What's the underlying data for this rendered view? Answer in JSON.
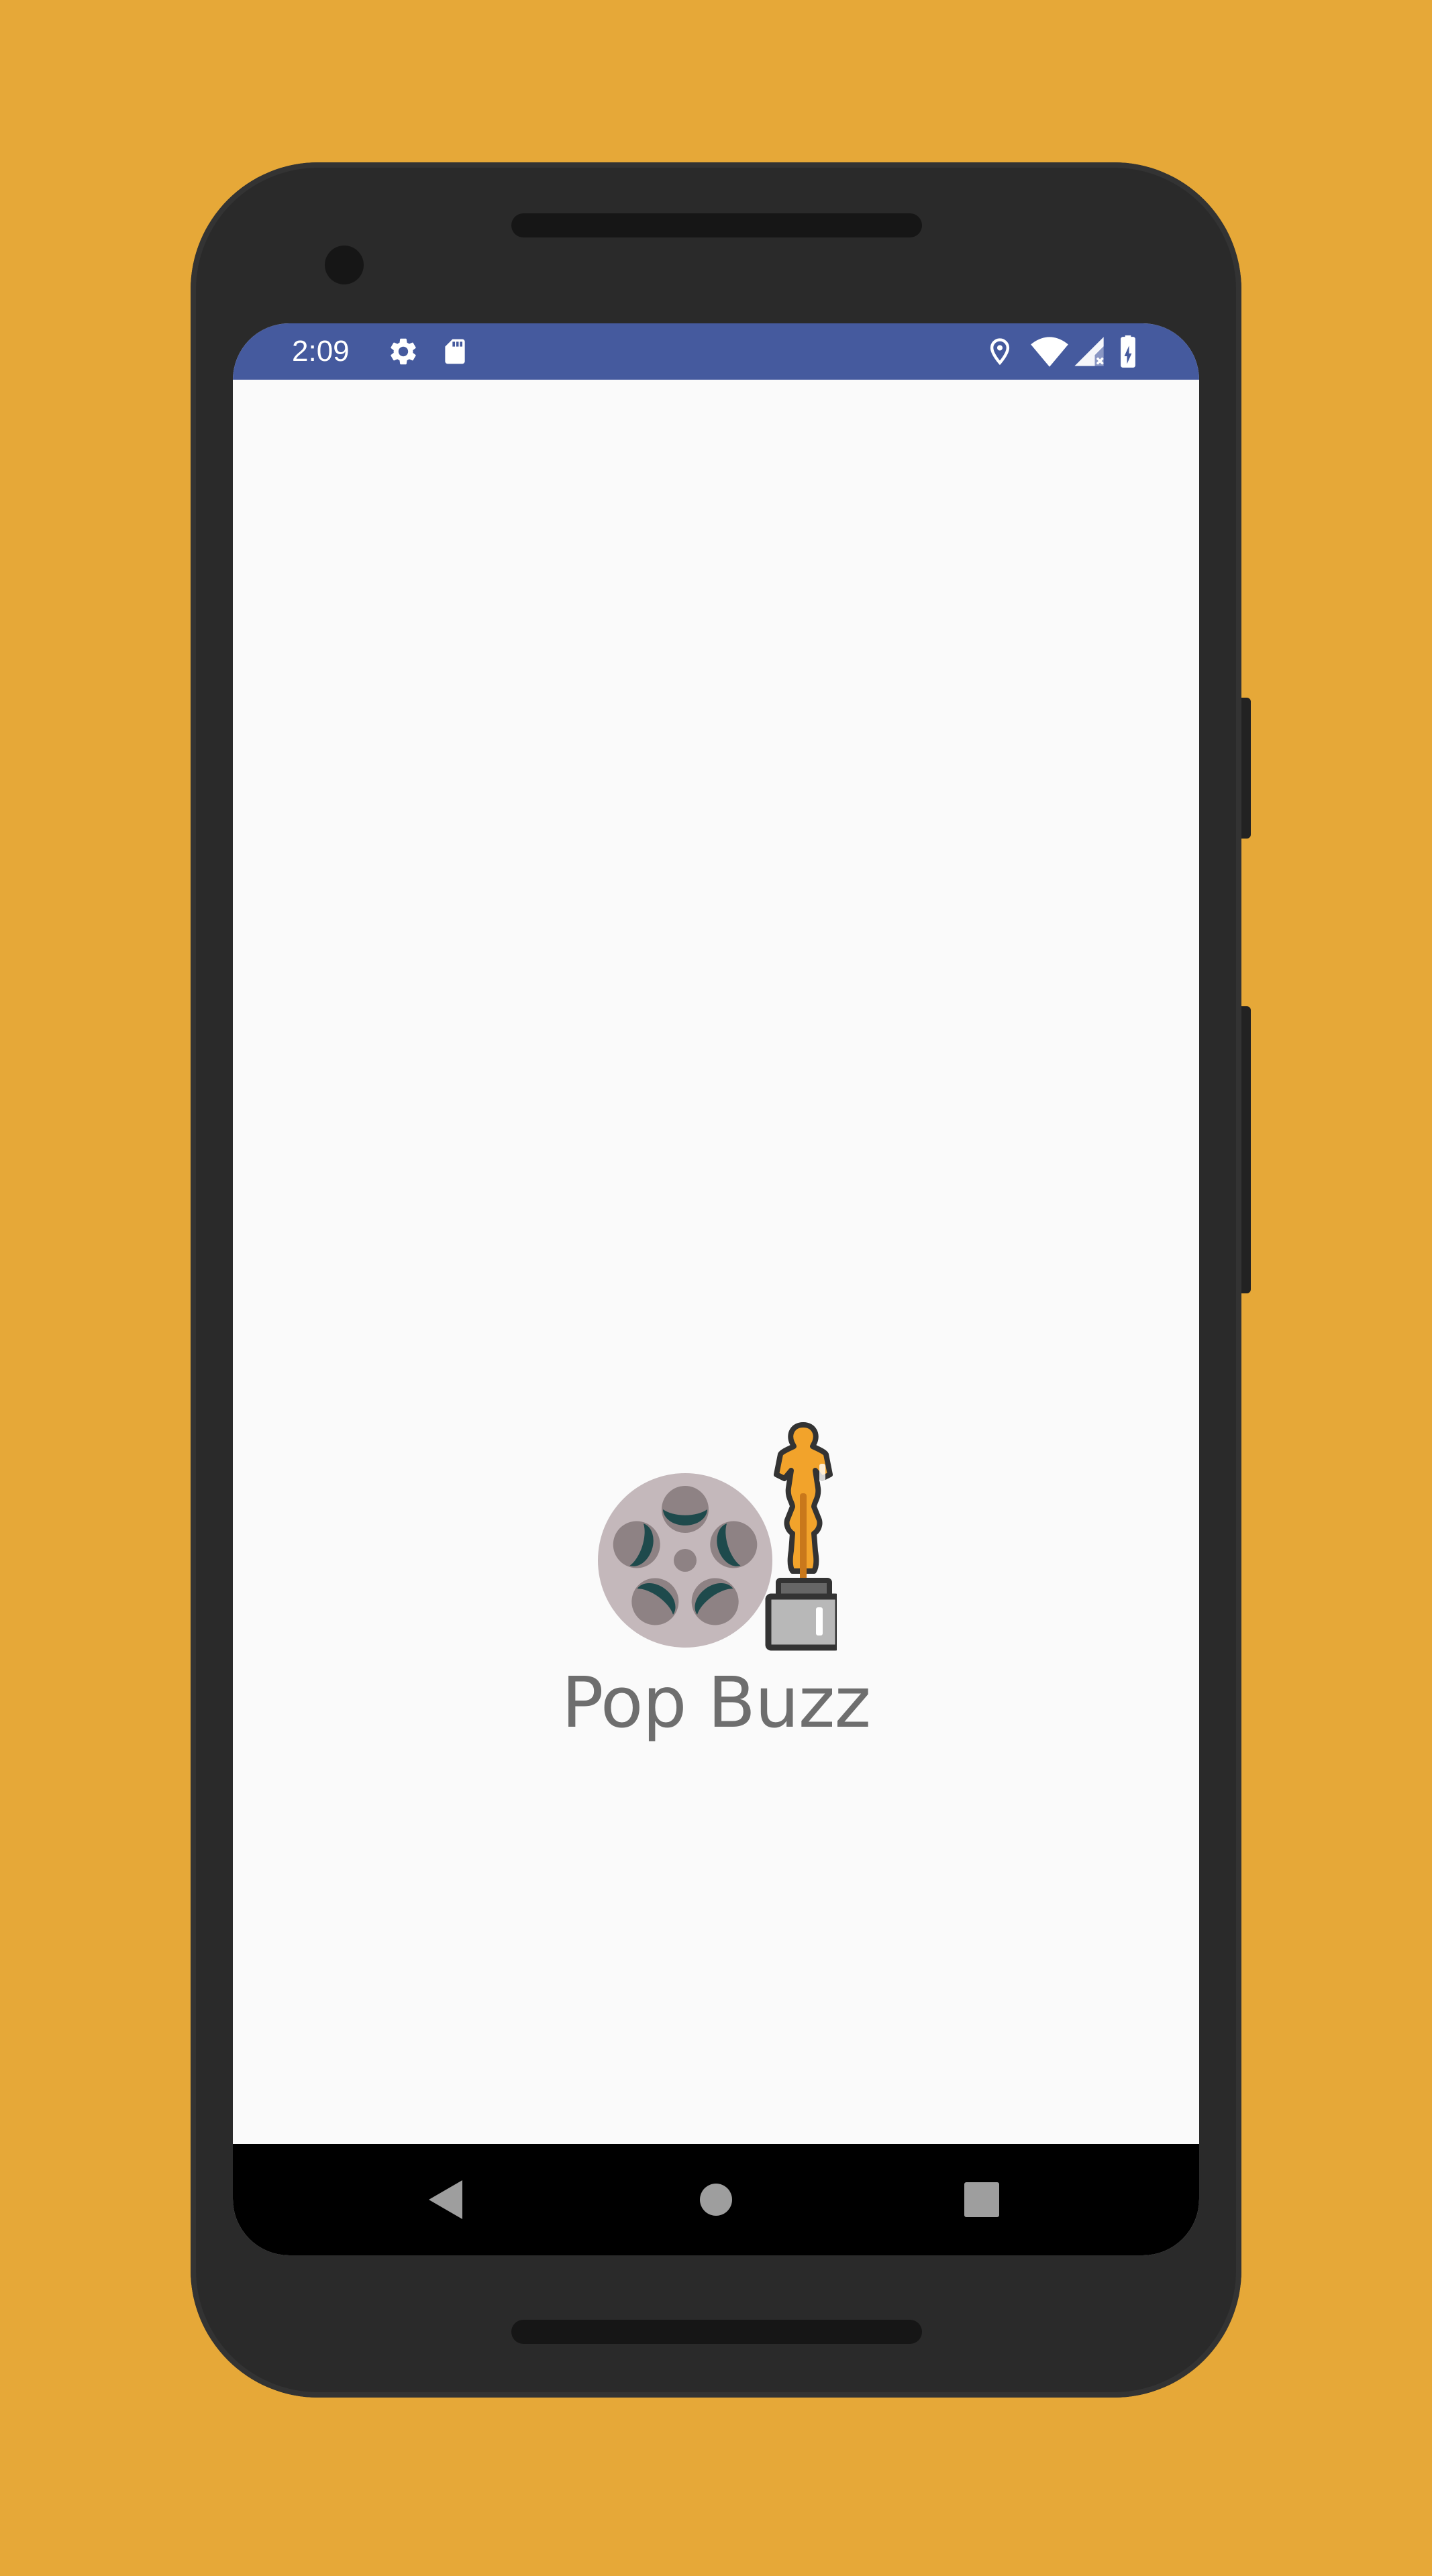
{
  "status_bar": {
    "time": "2:09",
    "left_icons": [
      "gear-icon",
      "sd-card-icon"
    ],
    "right_icons": [
      "location-icon",
      "wifi-icon",
      "cell-signal-no-service-icon",
      "battery-charging-icon"
    ],
    "color": "#455A9E"
  },
  "app": {
    "title": "Pop Buzz",
    "logo_icons": [
      "film-reel-icon",
      "trophy-statuette-icon"
    ],
    "background_color": "#FAFAFA"
  },
  "nav_bar": {
    "buttons": [
      "back-icon",
      "home-icon",
      "recents-icon"
    ]
  },
  "colors": {
    "backdrop": "#E6A838",
    "phone_body": "#2A2A2A",
    "title_text": "#6E6E6E",
    "statuette": "#F2A32B"
  }
}
